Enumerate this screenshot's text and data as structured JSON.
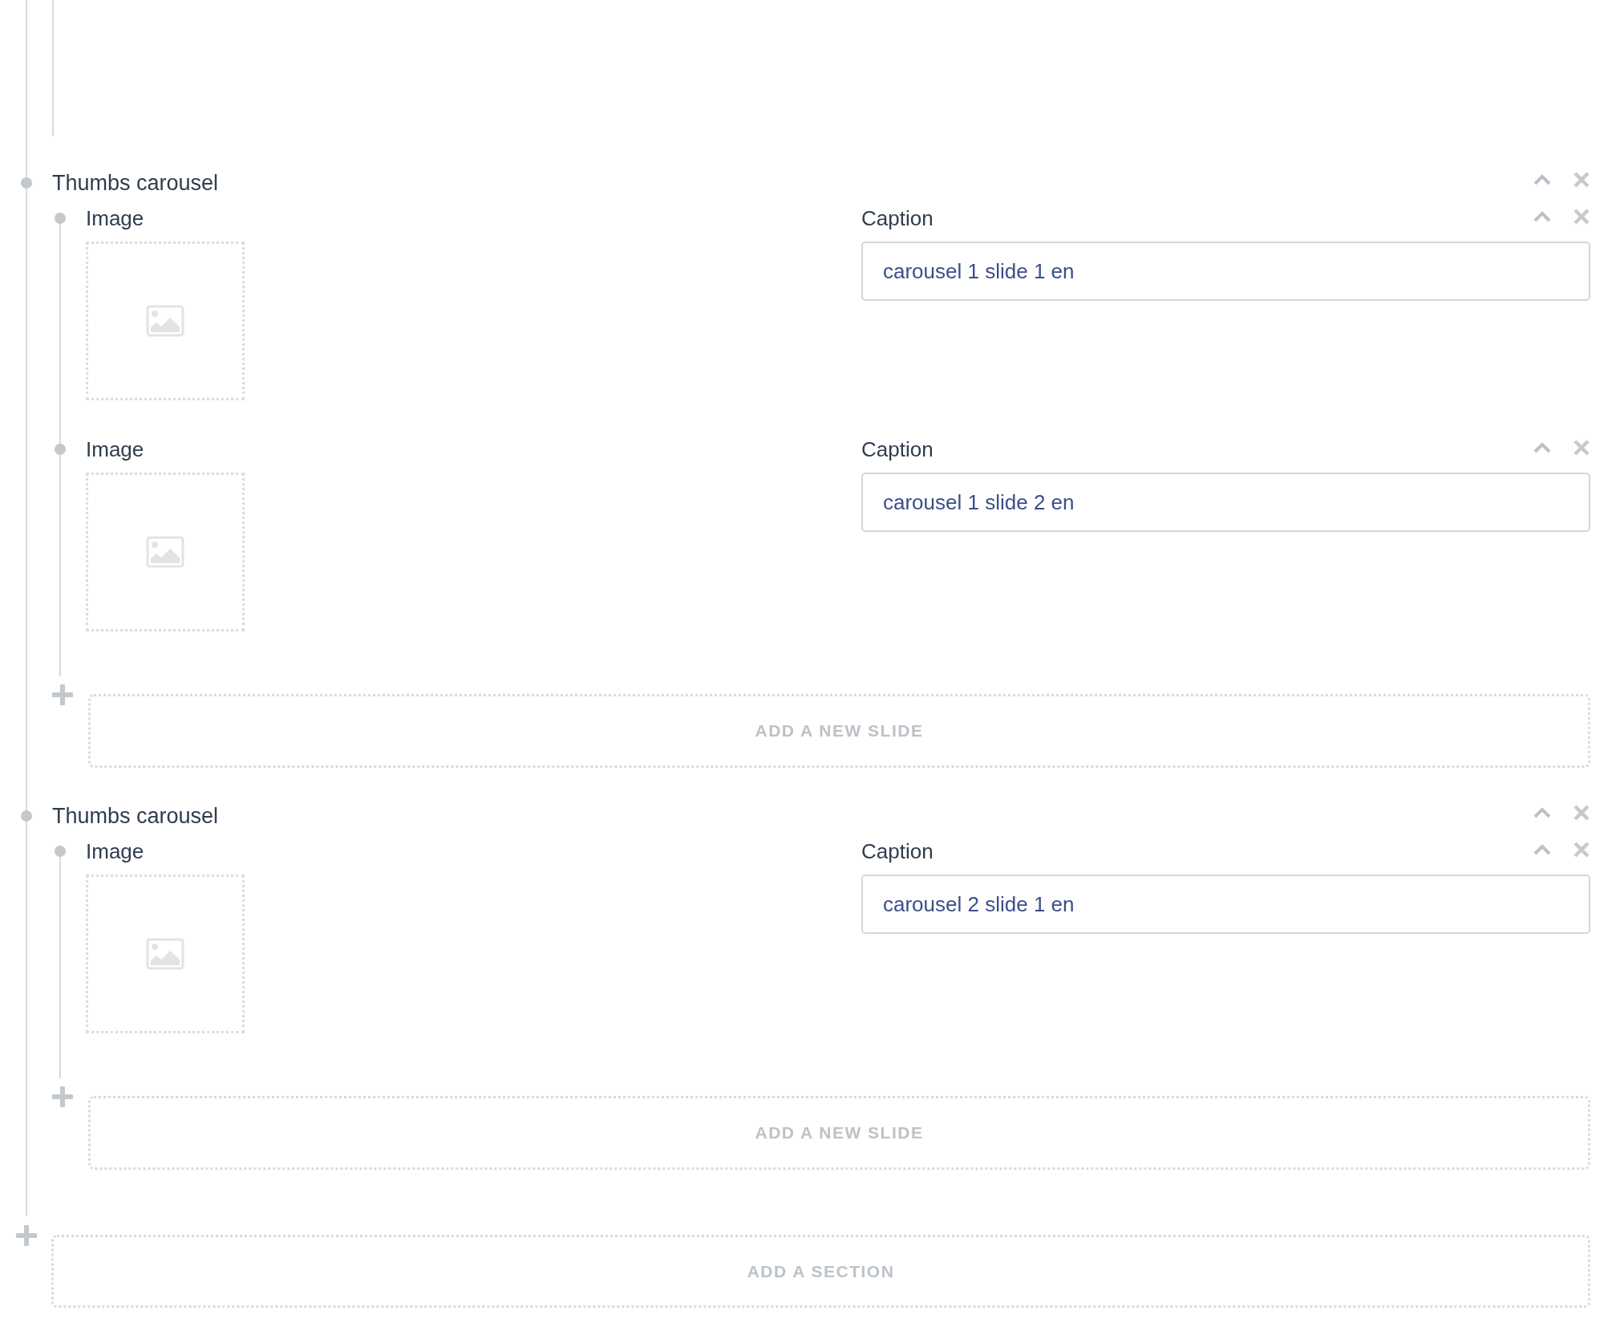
{
  "sections": [
    {
      "title": "Thumbs carousel",
      "slides": [
        {
          "image_label": "Image",
          "caption_label": "Caption",
          "caption": "carousel 1 slide 1 en"
        },
        {
          "image_label": "Image",
          "caption_label": "Caption",
          "caption": "carousel 1 slide 2 en"
        }
      ],
      "add_slide_label": "ADD A NEW SLIDE"
    },
    {
      "title": "Thumbs carousel",
      "slides": [
        {
          "image_label": "Image",
          "caption_label": "Caption",
          "caption": "carousel 2 slide 1 en"
        }
      ],
      "add_slide_label": "ADD A NEW SLIDE"
    }
  ],
  "add_section_label": "ADD A SECTION"
}
